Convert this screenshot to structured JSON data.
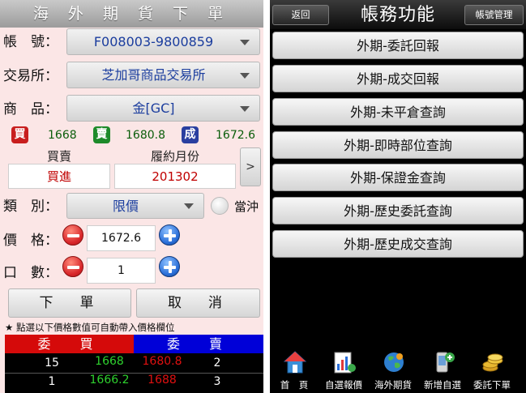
{
  "order_screen": {
    "title": "海 外 期 貨 下 單",
    "account": {
      "label": "帳　號：",
      "value": "F008003-9800859"
    },
    "exchange": {
      "label": "交易所：",
      "value": "芝加哥商品交易所"
    },
    "product": {
      "label": "商　品：",
      "value": "金[GC]"
    },
    "quote": {
      "buy_badge": "買",
      "buy_value": "1668",
      "sell_badge": "賣",
      "sell_value": "1680.8",
      "deal_badge": "成",
      "deal_value": "1672.6"
    },
    "side_header": "買賣",
    "month_header": "履約月份",
    "side_value": "買進",
    "month_value": "201302",
    "more_button": ">",
    "type": {
      "label": "類　別：",
      "value": "限價",
      "daytrade_label": "當沖"
    },
    "price": {
      "label": "價　格：",
      "value": "1672.6"
    },
    "quantity": {
      "label": "口　數：",
      "value": "1"
    },
    "submit_button": "下　單",
    "cancel_button": "取　消",
    "note": "★ 點選以下價格數值可自動帶入價格欄位",
    "ladder": {
      "bid_header": "委　買",
      "ask_header": "委　賣",
      "rows": [
        {
          "bid_qty": "15",
          "bid_price": "1668",
          "ask_price": "1680.8",
          "ask_qty": "2"
        },
        {
          "bid_qty": "1",
          "bid_price": "1666.2",
          "ask_price": "1688",
          "ask_qty": "3"
        }
      ]
    }
  },
  "account_menu": {
    "title": "帳務功能",
    "back_button": "返回",
    "manage_button": "帳號管理",
    "items": [
      "外期-委託回報",
      "外期-成交回報",
      "外期-未平倉查詢",
      "外期-即時部位查詢",
      "外期-保證金查詢",
      "外期-歷史委託查詢",
      "外期-歷史成交查詢"
    ],
    "tabs": [
      "首　頁",
      "自選報價",
      "海外期貨",
      "新增自選",
      "委託下單"
    ]
  },
  "colors": {
    "buy_badge": "#c81e1e",
    "sell_badge": "#1d8a2a",
    "deal_badge": "#2a3fa0",
    "bid_header_bg": "#d50a0a",
    "ask_header_bg": "#0000d8",
    "bid_price_green": "#2ed12e",
    "ask_price_red": "#e01010"
  }
}
